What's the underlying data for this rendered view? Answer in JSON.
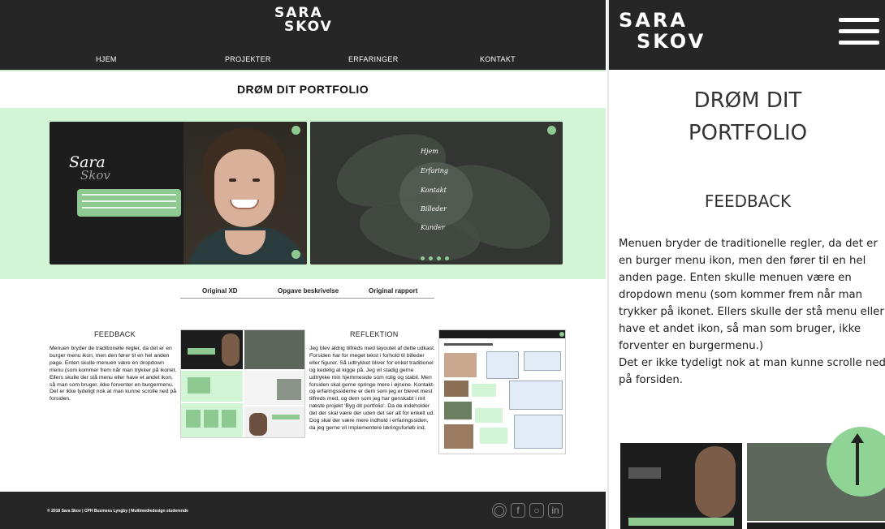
{
  "desktop": {
    "logo": {
      "line1": "SARA",
      "line2": "SKOV"
    },
    "nav": [
      "HJEM",
      "PROJEKTER",
      "ERFARINGER",
      "KONTAKT"
    ],
    "title": "DRØM DIT PORTFOLIO",
    "preview": {
      "brand_script": "Sara",
      "brand_script_sub": "Skov",
      "menu_items": [
        "Hjem",
        "Erfaring",
        "Kontakt",
        "Billeder",
        "Kunder"
      ]
    },
    "tabs": [
      "Original XD",
      "Opgave beskrivelse",
      "Original rapport"
    ],
    "feedback": {
      "heading": "FEEDBACK",
      "body": "Menuen bryder de traditionelle regler, da det er en burger menu ikon, men den fører til en hel anden page. Enten skulle menuen være en dropdown menu (som kommer frem når man trykker på ikonet. Ellers skulle der stå menu eller have et andet ikon, så man som bruger, ikke forventer en burgermenu. Det er ikke tydeligt nok at man kunne scrolle ned på forsiden."
    },
    "reflection": {
      "heading": "REFLEKTION",
      "body": "Jeg blev aldrig tilfreds med layoutet af dette udkast. Forsiden har for meget tekst i forhold til billeder eller figurer. Så udtrykket bliver for enkel traditionel og kedelig at kigge på. Jeg vil stadig gerne udtrykke min hjemmeside som rolig og stabil. Men forsiden skal gerne springe mere i øjnene. Kontakt- og erfaringssiderne er dem som jeg er blevet mest tilfreds med, og dem som jeg har genskabt i mit næste projekt 'Byg dit portfolio'. Da de indeholder det der skal være der uden det ser alt for enkelt ud. Dog skal der være mere indhold i erfaringssiden, da jeg gerne vil implementere læringsforløb ind."
    },
    "footer": {
      "copyright": "© 2018 Sara Skov | CPH Business Lyngby | Multimediedesign studerende",
      "social_icons": [
        "github-icon",
        "facebook-icon",
        "instagram-icon",
        "linkedin-icon"
      ]
    }
  },
  "mobile": {
    "logo": {
      "line1": "SARA",
      "line2": "SKOV"
    },
    "title_line1": "DRØM DIT",
    "title_line2": "PORTFOLIO",
    "feedback_heading": "FEEDBACK",
    "feedback_body": "Menuen bryder de traditionelle regler, da det er en burger menu ikon, men den fører til en hel anden page. Enten skulle menuen være en dropdown menu (som kommer frem når man trykker på ikonet. Ellers skulle der stå menu eller have et andet ikon, så man som bruger, ikke forventer en burgermenu.)",
    "feedback_body2": "Det er ikke tydeligt nok at man kunne scrolle ned på forsiden."
  },
  "colors": {
    "dark": "#262626",
    "mint": "#d2f6d5",
    "accent": "#8dc991"
  }
}
